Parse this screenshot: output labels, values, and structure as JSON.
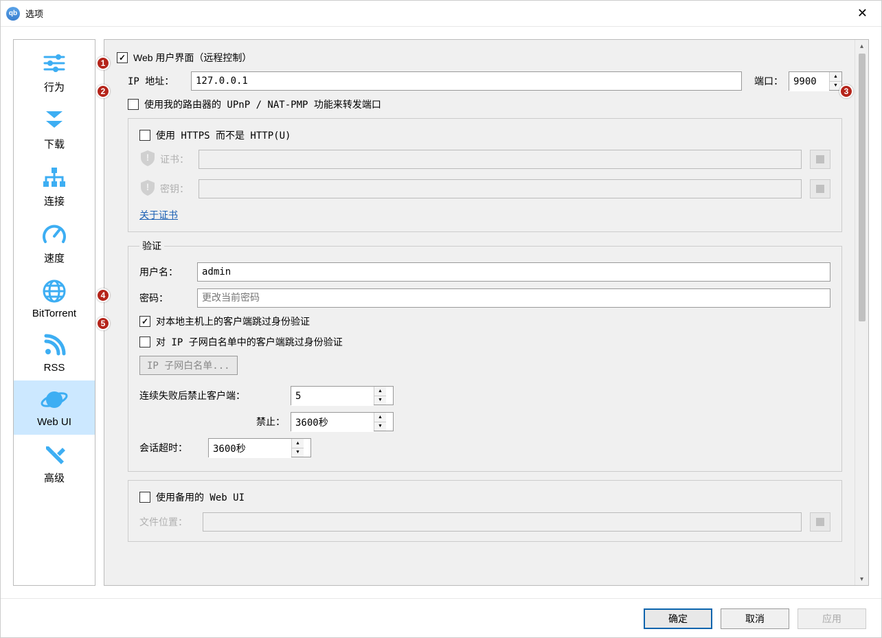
{
  "title": "选项",
  "sidebar": {
    "items": [
      {
        "label": "行为"
      },
      {
        "label": "下载"
      },
      {
        "label": "连接"
      },
      {
        "label": "速度"
      },
      {
        "label": "BitTorrent"
      },
      {
        "label": "RSS"
      },
      {
        "label": "Web UI"
      },
      {
        "label": "高级"
      }
    ]
  },
  "webui": {
    "enable_label": "Web 用户界面（远程控制）",
    "ip_label": "IP 地址：",
    "ip_value": "127.0.0.1",
    "port_label": "端口：",
    "port_value": "9900",
    "upnp_label": "使用我的路由器的 UPnP / NAT-PMP 功能来转发端口",
    "https": {
      "label": "使用 HTTPS 而不是 HTTP(U)",
      "cert_label": "证书：",
      "key_label": "密钥：",
      "about_link": "关于证书"
    },
    "auth": {
      "legend": "验证",
      "user_label": "用户名：",
      "user_value": "admin",
      "pass_label": "密码：",
      "pass_placeholder": "更改当前密码",
      "bypass_local": "对本地主机上的客户端跳过身份验证",
      "bypass_subnet": "对 IP 子网白名单中的客户端跳过身份验证",
      "subnet_button": "IP 子网白名单...",
      "ban_after_label": "连续失败后禁止客户端：",
      "ban_after_value": "5",
      "ban_for_label": "禁止：",
      "ban_for_value": "3600秒",
      "session_label": "会话超时：",
      "session_value": "3600秒"
    },
    "alt_ui": {
      "label": "使用备用的 Web UI",
      "path_label": "文件位置："
    }
  },
  "footer": {
    "ok": "确定",
    "cancel": "取消",
    "apply": "应用"
  },
  "markers": [
    "1",
    "2",
    "3",
    "4",
    "5"
  ]
}
